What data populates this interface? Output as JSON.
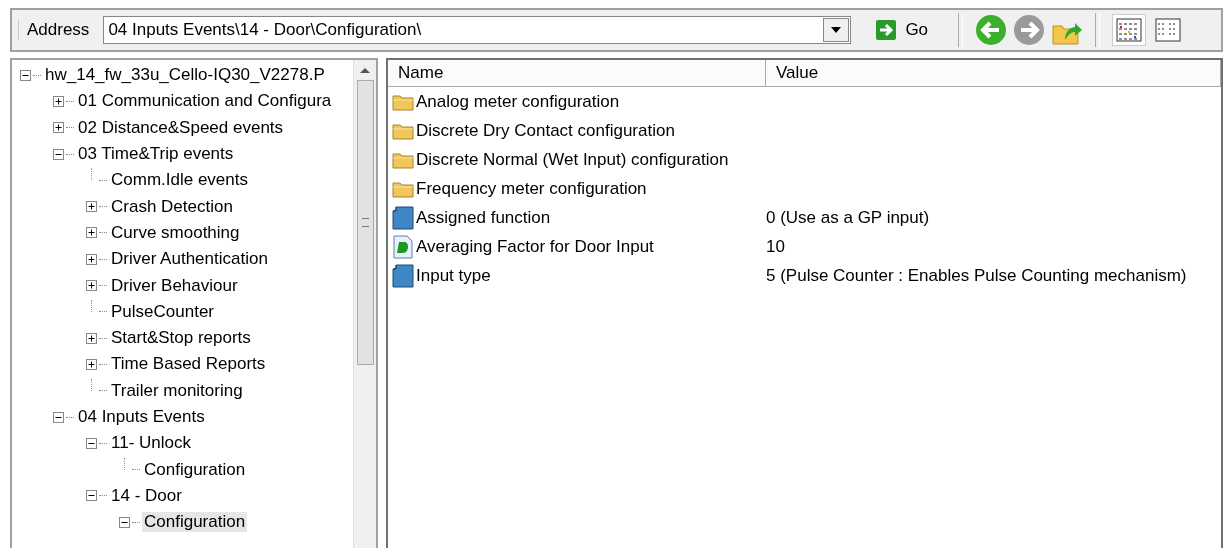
{
  "address_bar": {
    "label": "Address",
    "value": "04 Inputs Events\\14 - Door\\Configuration\\",
    "go_label": "Go"
  },
  "nav_buttons": [
    {
      "kind": "back",
      "disabled": false
    },
    {
      "kind": "forward",
      "disabled": true
    },
    {
      "kind": "up",
      "disabled": false
    }
  ],
  "view_buttons": [
    {
      "kind": "details",
      "selected": true
    },
    {
      "kind": "list",
      "selected": false
    }
  ],
  "tree": {
    "items": [
      {
        "label": "hw_14_fw_33u_Cello-IQ30_V2278.P",
        "expanded": true,
        "selected": false,
        "children": [
          {
            "label": "01 Communication and Configura",
            "expanded": false,
            "selected": false
          },
          {
            "label": "02 Distance&Speed events",
            "expanded": false,
            "selected": false
          },
          {
            "label": "03 Time&Trip events",
            "expanded": true,
            "selected": false,
            "children": [
              {
                "label": "Comm.Idle events",
                "selected": false
              },
              {
                "label": "Crash Detection",
                "expanded": false,
                "selected": false
              },
              {
                "label": "Curve smoothing",
                "expanded": false,
                "selected": false
              },
              {
                "label": "Driver Authentication",
                "expanded": false,
                "selected": false
              },
              {
                "label": "Driver Behaviour",
                "expanded": false,
                "selected": false
              },
              {
                "label": "PulseCounter",
                "selected": false
              },
              {
                "label": "Start&Stop reports",
                "expanded": false,
                "selected": false
              },
              {
                "label": "Time Based Reports",
                "expanded": false,
                "selected": false
              },
              {
                "label": "Trailer monitoring",
                "selected": false
              }
            ]
          },
          {
            "label": "04 Inputs Events",
            "expanded": true,
            "selected": false,
            "children": [
              {
                "label": "11- Unlock",
                "expanded": true,
                "selected": false,
                "children": [
                  {
                    "label": "Configuration",
                    "selected": false
                  }
                ]
              },
              {
                "label": "14 - Door",
                "expanded": true,
                "selected": false,
                "children": [
                  {
                    "label": "Configuration",
                    "expanded": true,
                    "selected": true
                  }
                ]
              }
            ]
          }
        ]
      }
    ]
  },
  "list": {
    "columns": [
      "Name",
      "Value"
    ],
    "rows": [
      {
        "kind": "folder",
        "name": "Analog meter configuration",
        "selected": false
      },
      {
        "kind": "folder",
        "name": "Discrete Dry Contact configuration",
        "selected": false
      },
      {
        "kind": "folder",
        "name": "Discrete Normal (Wet Input) configuration",
        "selected": false
      },
      {
        "kind": "folder",
        "name": "Frequency meter configuration",
        "selected": false
      },
      {
        "kind": "param",
        "name": "Assigned function",
        "value": "0 (Use as a GP input)",
        "selected": false
      },
      {
        "kind": "dparam",
        "name": "Averaging Factor for Door Input",
        "value": "10",
        "selected": false
      },
      {
        "kind": "param",
        "name": "Input type",
        "value": "5 (Pulse Counter : Enables Pulse Counting mechanism)",
        "selected": false
      }
    ]
  }
}
